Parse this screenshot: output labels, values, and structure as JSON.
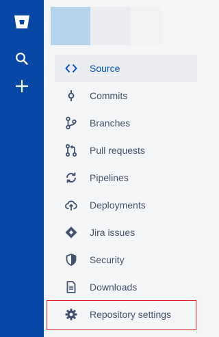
{
  "sidebar": {
    "items": [
      {
        "label": "Source",
        "icon": "code-icon",
        "active": true
      },
      {
        "label": "Commits",
        "icon": "commit-icon"
      },
      {
        "label": "Branches",
        "icon": "branch-icon"
      },
      {
        "label": "Pull requests",
        "icon": "pull-request-icon"
      },
      {
        "label": "Pipelines",
        "icon": "pipelines-icon"
      },
      {
        "label": "Deployments",
        "icon": "cloud-upload-icon"
      },
      {
        "label": "Jira issues",
        "icon": "jira-icon"
      },
      {
        "label": "Security",
        "icon": "shield-icon"
      },
      {
        "label": "Downloads",
        "icon": "document-icon"
      },
      {
        "label": "Repository settings",
        "icon": "gear-icon"
      }
    ]
  },
  "colors": {
    "global_nav_bg": "#0747a6",
    "sidebar_bg": "#f4f5f7",
    "active_text": "#0052cc",
    "text": "#42526e",
    "highlight_border": "#e01f1f"
  }
}
